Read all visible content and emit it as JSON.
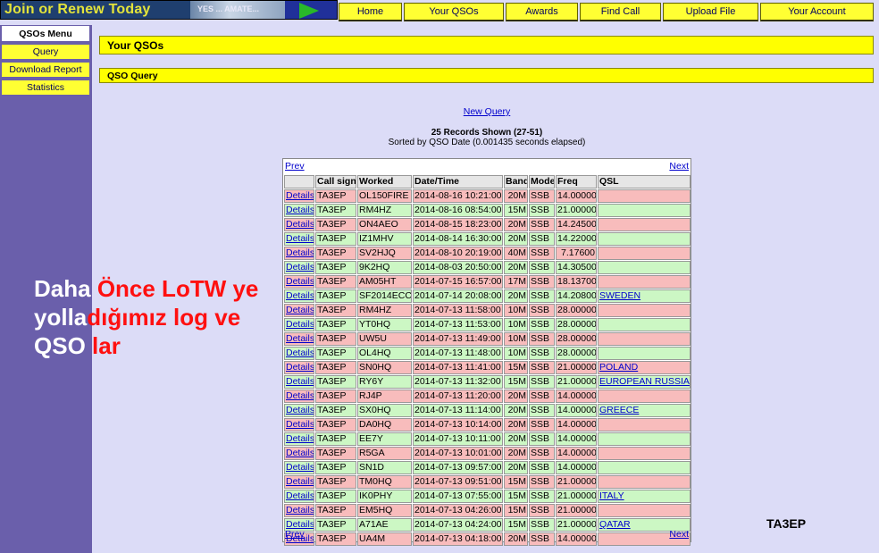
{
  "banner": {
    "text": "Join or Renew Today",
    "art_text": "YES ... AMATE..."
  },
  "topnav": [
    {
      "label": "Home"
    },
    {
      "label": "Your QSOs"
    },
    {
      "label": "Awards"
    },
    {
      "label": "Find Call"
    },
    {
      "label": "Upload File"
    },
    {
      "label": "Your Account"
    }
  ],
  "sidebar": {
    "title": "QSOs Menu",
    "items": [
      {
        "label": "Query"
      },
      {
        "label": "Download Report"
      },
      {
        "label": "Statistics"
      }
    ]
  },
  "page": {
    "title": "Your QSOs",
    "section": "QSO Query",
    "new_query": "New Query",
    "records_shown": "25 Records Shown (27-51)",
    "sorted_by": "Sorted by QSO Date (0.001435 seconds elapsed)"
  },
  "pager": {
    "prev": "Prev",
    "next": "Next"
  },
  "table": {
    "headers": [
      "",
      "Call sign",
      "Worked",
      "Date/Time",
      "Band",
      "Mode",
      "Freq",
      "QSL"
    ],
    "details_label": "Details",
    "rows": [
      {
        "call": "TA3EP",
        "worked": "OL150FIRE",
        "dt": "2014-08-16 10:21:00",
        "band": "20M",
        "mode": "SSB",
        "freq": "14.00000",
        "qsl": "",
        "color": "pink"
      },
      {
        "call": "TA3EP",
        "worked": "RM4HZ",
        "dt": "2014-08-16 08:54:00",
        "band": "15M",
        "mode": "SSB",
        "freq": "21.00000",
        "qsl": "",
        "color": "green"
      },
      {
        "call": "TA3EP",
        "worked": "ON4AEO",
        "dt": "2014-08-15 18:23:00",
        "band": "20M",
        "mode": "SSB",
        "freq": "14.24500",
        "qsl": "",
        "color": "pink"
      },
      {
        "call": "TA3EP",
        "worked": "IZ1MHV",
        "dt": "2014-08-14 16:30:00",
        "band": "20M",
        "mode": "SSB",
        "freq": "14.22000",
        "qsl": "",
        "color": "green"
      },
      {
        "call": "TA3EP",
        "worked": "SV2HJQ",
        "dt": "2014-08-10 20:19:00",
        "band": "40M",
        "mode": "SSB",
        "freq": "7.17600",
        "qsl": "",
        "color": "pink"
      },
      {
        "call": "TA3EP",
        "worked": "9K2HQ",
        "dt": "2014-08-03 20:50:00",
        "band": "20M",
        "mode": "SSB",
        "freq": "14.30500",
        "qsl": "",
        "color": "green"
      },
      {
        "call": "TA3EP",
        "worked": "AM05HT",
        "dt": "2014-07-15 16:57:00",
        "band": "17M",
        "mode": "SSB",
        "freq": "18.13700",
        "qsl": "",
        "color": "pink"
      },
      {
        "call": "TA3EP",
        "worked": "SF2014ECC",
        "dt": "2014-07-14 20:08:00",
        "band": "20M",
        "mode": "SSB",
        "freq": "14.20800",
        "qsl": "SWEDEN",
        "color": "green"
      },
      {
        "call": "TA3EP",
        "worked": "RM4HZ",
        "dt": "2014-07-13 11:58:00",
        "band": "10M",
        "mode": "SSB",
        "freq": "28.00000",
        "qsl": "",
        "color": "pink"
      },
      {
        "call": "TA3EP",
        "worked": "YT0HQ",
        "dt": "2014-07-13 11:53:00",
        "band": "10M",
        "mode": "SSB",
        "freq": "28.00000",
        "qsl": "",
        "color": "green"
      },
      {
        "call": "TA3EP",
        "worked": "UW5U",
        "dt": "2014-07-13 11:49:00",
        "band": "10M",
        "mode": "SSB",
        "freq": "28.00000",
        "qsl": "",
        "color": "pink"
      },
      {
        "call": "TA3EP",
        "worked": "OL4HQ",
        "dt": "2014-07-13 11:48:00",
        "band": "10M",
        "mode": "SSB",
        "freq": "28.00000",
        "qsl": "",
        "color": "green"
      },
      {
        "call": "TA3EP",
        "worked": "SN0HQ",
        "dt": "2014-07-13 11:41:00",
        "band": "15M",
        "mode": "SSB",
        "freq": "21.00000",
        "qsl": "POLAND",
        "color": "pink"
      },
      {
        "call": "TA3EP",
        "worked": "RY6Y",
        "dt": "2014-07-13 11:32:00",
        "band": "15M",
        "mode": "SSB",
        "freq": "21.00000",
        "qsl": "EUROPEAN RUSSIA",
        "color": "green"
      },
      {
        "call": "TA3EP",
        "worked": "RJ4P",
        "dt": "2014-07-13 11:20:00",
        "band": "20M",
        "mode": "SSB",
        "freq": "14.00000",
        "qsl": "",
        "color": "pink"
      },
      {
        "call": "TA3EP",
        "worked": "SX0HQ",
        "dt": "2014-07-13 11:14:00",
        "band": "20M",
        "mode": "SSB",
        "freq": "14.00000",
        "qsl": "GREECE",
        "color": "green"
      },
      {
        "call": "TA3EP",
        "worked": "DA0HQ",
        "dt": "2014-07-13 10:14:00",
        "band": "20M",
        "mode": "SSB",
        "freq": "14.00000",
        "qsl": "",
        "color": "pink"
      },
      {
        "call": "TA3EP",
        "worked": "EE7Y",
        "dt": "2014-07-13 10:11:00",
        "band": "20M",
        "mode": "SSB",
        "freq": "14.00000",
        "qsl": "",
        "color": "green"
      },
      {
        "call": "TA3EP",
        "worked": "R5GA",
        "dt": "2014-07-13 10:01:00",
        "band": "20M",
        "mode": "SSB",
        "freq": "14.00000",
        "qsl": "",
        "color": "pink"
      },
      {
        "call": "TA3EP",
        "worked": "SN1D",
        "dt": "2014-07-13 09:57:00",
        "band": "20M",
        "mode": "SSB",
        "freq": "14.00000",
        "qsl": "",
        "color": "green"
      },
      {
        "call": "TA3EP",
        "worked": "TM0HQ",
        "dt": "2014-07-13 09:51:00",
        "band": "15M",
        "mode": "SSB",
        "freq": "21.00000",
        "qsl": "",
        "color": "pink"
      },
      {
        "call": "TA3EP",
        "worked": "IK0PHY",
        "dt": "2014-07-13 07:55:00",
        "band": "15M",
        "mode": "SSB",
        "freq": "21.00000",
        "qsl": "ITALY",
        "color": "green"
      },
      {
        "call": "TA3EP",
        "worked": "EM5HQ",
        "dt": "2014-07-13 04:26:00",
        "band": "15M",
        "mode": "SSB",
        "freq": "21.00000",
        "qsl": "",
        "color": "pink"
      },
      {
        "call": "TA3EP",
        "worked": "A71AE",
        "dt": "2014-07-13 04:24:00",
        "band": "15M",
        "mode": "SSB",
        "freq": "21.00000",
        "qsl": "QATAR",
        "color": "green"
      },
      {
        "call": "TA3EP",
        "worked": "UA4M",
        "dt": "2014-07-13 04:18:00",
        "band": "20M",
        "mode": "SSB",
        "freq": "14.00000",
        "qsl": "",
        "color": "pink"
      }
    ]
  },
  "overlay": {
    "line1_white": "Daha ",
    "line1_red": "Önce LoTW ye",
    "line2_white": "yolla",
    "line2_red": "dığımız log ve",
    "line3_white": "QSO ",
    "line3_red": "lar"
  },
  "signature": "TA3EP",
  "colors": {
    "background": "#dcdcf7",
    "sidebar": "#6a5fab",
    "yellow": "#ffff33",
    "row_pink": "#f8bcbc",
    "row_green": "#ccf7c4",
    "link": "#0000cc",
    "overlay_red": "#ff1010"
  },
  "icons": [
    "banner-graphic",
    "green-arrow-icon"
  ]
}
